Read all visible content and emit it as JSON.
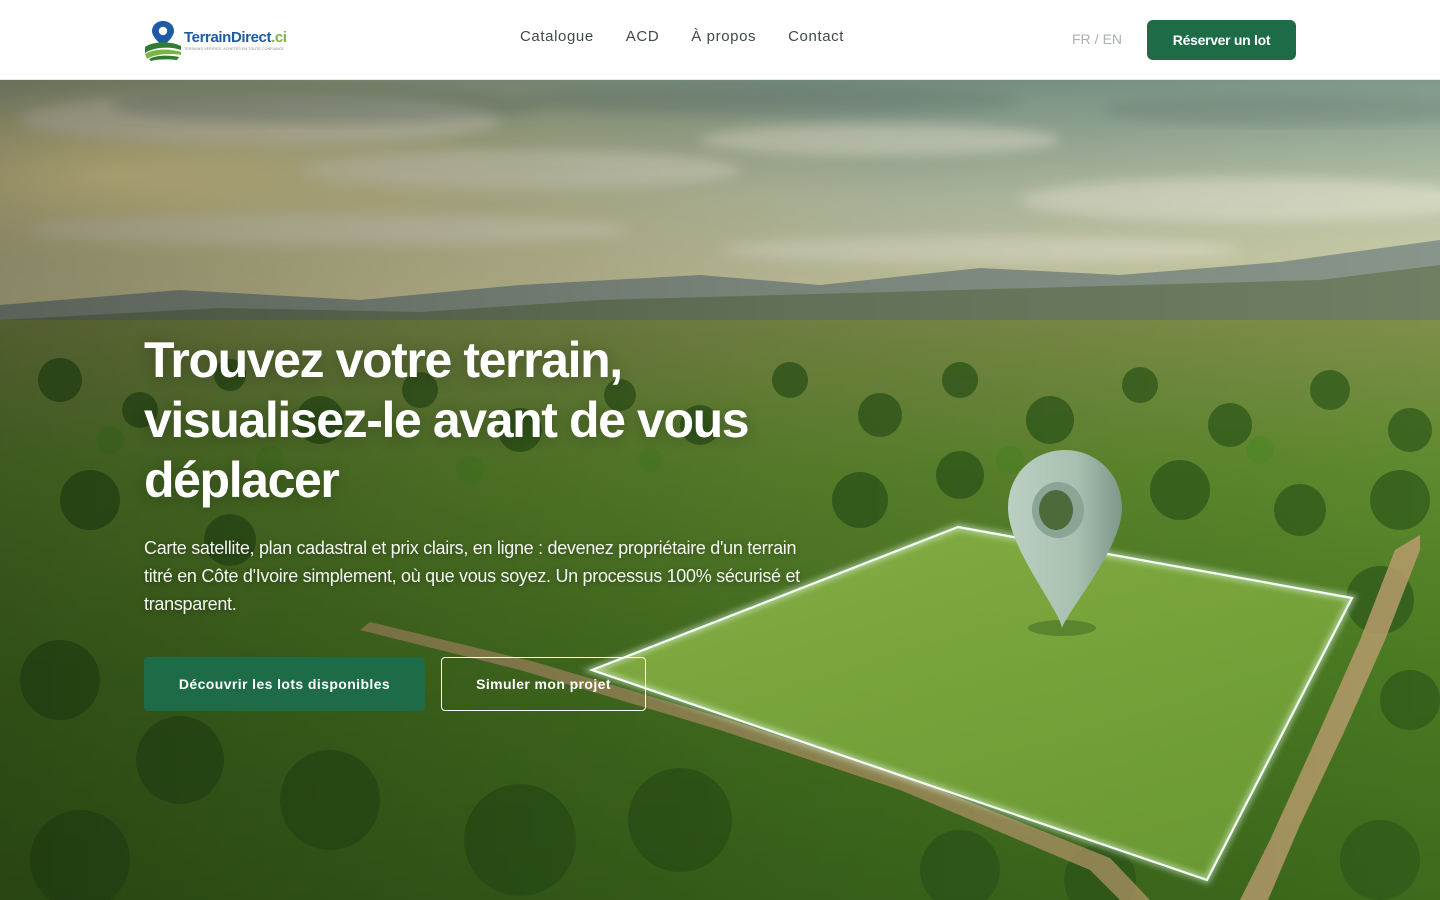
{
  "header": {
    "logo": {
      "name": "TerrainDirect",
      "tld": ".ci",
      "tagline": "TERRAINS VÉRIFIÉS, ACHETÉS EN TOUTE CONFIANCE"
    },
    "nav": [
      {
        "label": "Catalogue"
      },
      {
        "label": "ACD"
      },
      {
        "label": "À propos"
      },
      {
        "label": "Contact"
      }
    ],
    "lang": {
      "fr": "FR",
      "sep": "/",
      "en": "EN"
    },
    "reserve_label": "Réserver un lot"
  },
  "hero": {
    "title_lines": [
      "Trouvez votre terrain,",
      "visualisez-le avant de vous",
      "déplacer"
    ],
    "subtitle": "Carte satellite, plan cadastral et prix clairs, en ligne : devenez propriétaire d'un terrain titré en Côte d'Ivoire simplement, où que vous soyez. Un processus 100% sécurisé et transparent.",
    "primary_cta": "Découvrir les lots disponibles",
    "secondary_cta": "Simuler mon projet"
  },
  "colors": {
    "brand_green": "#1e6b48",
    "logo_blue": "#1f5aa6",
    "logo_accent": "#7cb342"
  },
  "icons": {
    "logo_mark": "location-pin-field-icon",
    "map_pin": "map-pin-icon"
  }
}
